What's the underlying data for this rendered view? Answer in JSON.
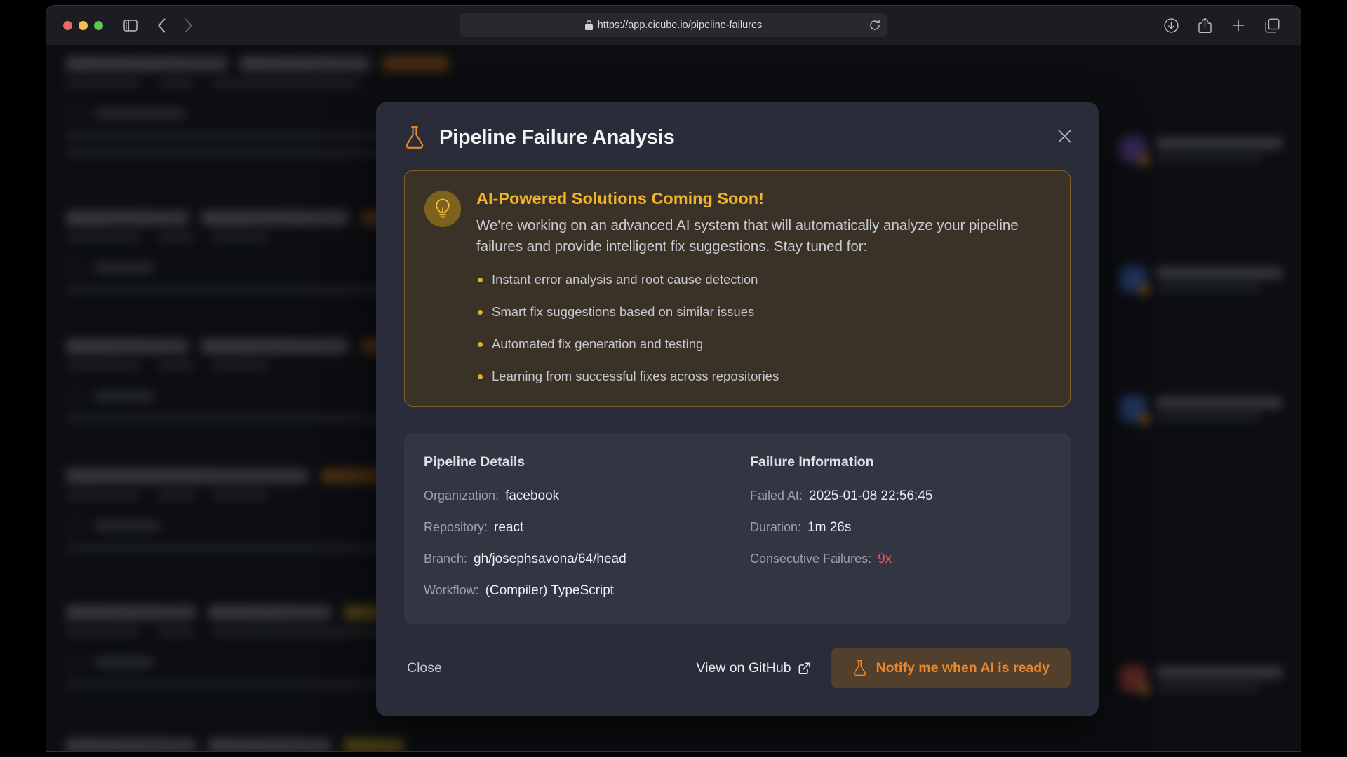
{
  "browser": {
    "url": "https://app.cicube.io/pipeline-failures",
    "lock_icon": "lock-icon",
    "reload_icon": "reload-icon",
    "sidebar_icon": "sidebar-toggle-icon",
    "back_icon": "chevron-left-icon",
    "forward_icon": "chevron-right-icon",
    "shield_icon": "shield-icon",
    "download_icon": "download-icon",
    "share_icon": "share-icon",
    "new_tab_icon": "plus-icon",
    "tab_overview_icon": "tab-overview-icon",
    "traffic_lights": [
      "close",
      "minimize",
      "zoom"
    ]
  },
  "modal": {
    "title": "Pipeline Failure Analysis",
    "title_icon": "flask-icon",
    "close_icon": "close-icon",
    "alert": {
      "icon": "lightbulb-icon",
      "title": "AI-Powered Solutions Coming Soon!",
      "text": "We're working on an advanced AI system that will automatically analyze your pipeline failures and provide intelligent fix suggestions. Stay tuned for:",
      "items": [
        "Instant error analysis and root cause detection",
        "Smart fix suggestions based on similar issues",
        "Automated fix generation and testing",
        "Learning from successful fixes across repositories"
      ]
    },
    "pipeline_details": {
      "heading": "Pipeline Details",
      "rows": [
        {
          "label": "Organization:",
          "value": "facebook"
        },
        {
          "label": "Repository:",
          "value": "react"
        },
        {
          "label": "Branch:",
          "value": "gh/josephsavona/64/head"
        },
        {
          "label": "Workflow:",
          "value": "(Compiler) TypeScript"
        }
      ]
    },
    "failure_information": {
      "heading": "Failure Information",
      "rows": [
        {
          "label": "Failed At:",
          "value": "2025-01-08 22:56:45"
        },
        {
          "label": "Duration:",
          "value": "1m 26s"
        },
        {
          "label": "Consecutive Failures:",
          "value": "9x"
        }
      ]
    },
    "footer": {
      "close_label": "Close",
      "github_label": "View on GitHub",
      "github_icon": "external-link-icon",
      "notify_label": "Notify me when AI is ready",
      "notify_icon": "flask-icon"
    }
  },
  "colors": {
    "accent_orange": "#e8872b",
    "alert_amber": "#f0b32c",
    "danger_red": "#ef5350",
    "modal_bg": "#2a2d39",
    "panel_bg": "#323542",
    "alert_bg": "#3a3226",
    "alert_border": "#7d6027"
  }
}
